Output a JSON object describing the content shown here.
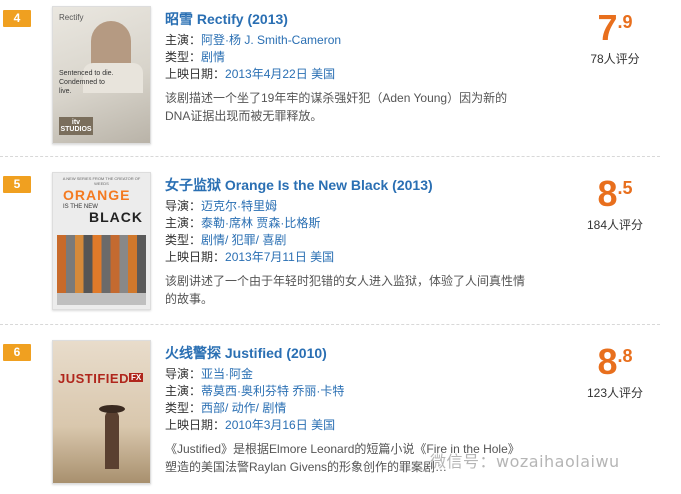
{
  "entries": [
    {
      "rank": "4",
      "title": "昭雪 Rectify (2013)",
      "poster_label": "Rectify",
      "poster_tagline": "Sentenced to die. Condemned to live.",
      "poster_network": "itv STUDIOS",
      "starring_label": "主演：",
      "starring": "阿登·杨  J. Smith-Cameron",
      "genre_label": "类型：",
      "genre": "剧情",
      "release_label": "上映日期：",
      "release": "2013年4月22日 美国",
      "description": "该剧描述一个坐了19年牢的谋杀强奸犯（Aden Young）因为新的DNA证据出现而被无罪释放。",
      "score_int": "7",
      "score_dec": ".9",
      "votes": "78人评分"
    },
    {
      "rank": "5",
      "title": "女子监狱 Orange Is the New Black (2013)",
      "poster_top": "A NEW SERIES FROM THE CREATOR OF WEEDS",
      "poster_label1": "ORANGE",
      "poster_label2": "BLACK",
      "poster_label_mid": "IS THE NEW",
      "director_label": "导演：",
      "director": "迈克尔·特里姆",
      "starring_label": "主演：",
      "starring": "泰勒·席林  贾森·比格斯",
      "genre_label": "类型：",
      "genre": "剧情/ 犯罪/ 喜剧",
      "release_label": "上映日期：",
      "release": "2013年7月11日 美国",
      "description": "该剧讲述了一个由于年轻时犯错的女人进入监狱，体验了人间真性情的故事。",
      "score_int": "8",
      "score_dec": ".5",
      "votes": "184人评分"
    },
    {
      "rank": "6",
      "title": "火线警探 Justified (2010)",
      "poster_label": "JUSTIFIED",
      "poster_network": "FX",
      "director_label": "导演：",
      "director": "亚当·阿金",
      "starring_label": "主演：",
      "starring": "蒂莫西·奥利芬特  乔丽·卡特",
      "genre_label": "类型：",
      "genre": "西部/ 动作/ 剧情",
      "release_label": "上映日期：",
      "release": "2010年3月16日 美国",
      "description": "《Justified》是根据Elmore Leonard的短篇小说《Fire in the Hole》塑造的美国法警Raylan Givens的形象创作的罪案剧…",
      "score_int": "8",
      "score_dec": ".8",
      "votes": "123人评分"
    }
  ],
  "watermark": "微信号：wozaihaolaiwu",
  "colors": {
    "accent": "#e86f1d",
    "link": "#2a6fb3",
    "rank_badge": "#f0a020"
  }
}
